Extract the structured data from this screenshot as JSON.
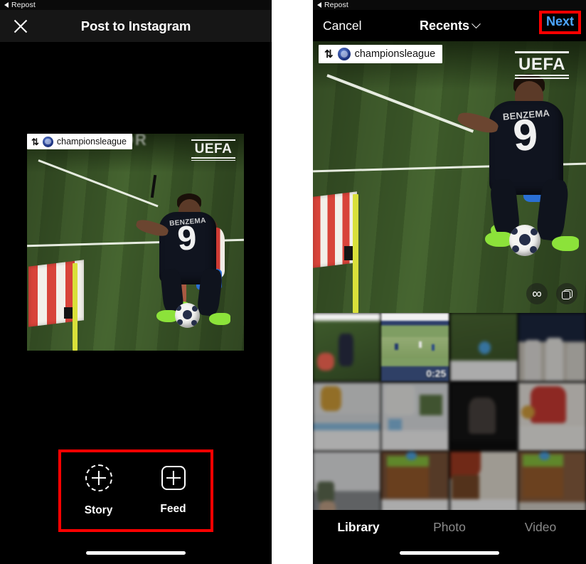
{
  "status_bar": {
    "back_icon": "back-triangle-icon",
    "app_label": "Repost"
  },
  "left_panel": {
    "nav": {
      "close_icon": "close-icon",
      "title": "Post to Instagram"
    },
    "preview": {
      "watermark": {
        "repost_icon": "repost-icon",
        "avatar": "championsleague-avatar",
        "username": "championsleague"
      },
      "broadcaster_logo": "UEFA",
      "banner_text": "HORROR",
      "player_name": "BENZEMA",
      "player_number": "9"
    },
    "actions": {
      "highlight_color": "#ff0000",
      "items": [
        {
          "icon": "story-plus-icon",
          "label": "Story"
        },
        {
          "icon": "feed-plus-icon",
          "label": "Feed"
        }
      ]
    }
  },
  "right_panel": {
    "nav": {
      "cancel_label": "Cancel",
      "album_label": "Recents",
      "album_chevron": "chevron-down-icon",
      "next_label": "Next",
      "next_color": "#4da6ff",
      "next_highlight_color": "#ff0000"
    },
    "preview": {
      "watermark": {
        "repost_icon": "repost-icon",
        "avatar": "championsleague-avatar",
        "username": "championsleague"
      },
      "broadcaster_logo": "UEFA",
      "player_name": "BENZEMA",
      "player_number": "9",
      "overlay_buttons": [
        {
          "icon": "infinity-loop-icon",
          "label": "∞"
        },
        {
          "icon": "multi-select-icon",
          "label": ""
        }
      ]
    },
    "grid": {
      "thumbnails": [
        {
          "id": 1,
          "selected": false,
          "duration": ""
        },
        {
          "id": 2,
          "selected": true,
          "duration": "0:25"
        },
        {
          "id": 3,
          "selected": false,
          "duration": ""
        },
        {
          "id": 4,
          "selected": false,
          "duration": ""
        },
        {
          "id": 5,
          "selected": false,
          "duration": ""
        },
        {
          "id": 6,
          "selected": false,
          "duration": ""
        },
        {
          "id": 7,
          "selected": false,
          "duration": ""
        },
        {
          "id": 8,
          "selected": false,
          "duration": ""
        },
        {
          "id": 9,
          "selected": false,
          "duration": ""
        },
        {
          "id": 10,
          "selected": false,
          "duration": ""
        },
        {
          "id": 11,
          "selected": false,
          "duration": ""
        },
        {
          "id": 12,
          "selected": false,
          "duration": ""
        }
      ]
    },
    "tabs": [
      {
        "label": "Library",
        "active": true
      },
      {
        "label": "Photo",
        "active": false
      },
      {
        "label": "Video",
        "active": false
      }
    ]
  }
}
